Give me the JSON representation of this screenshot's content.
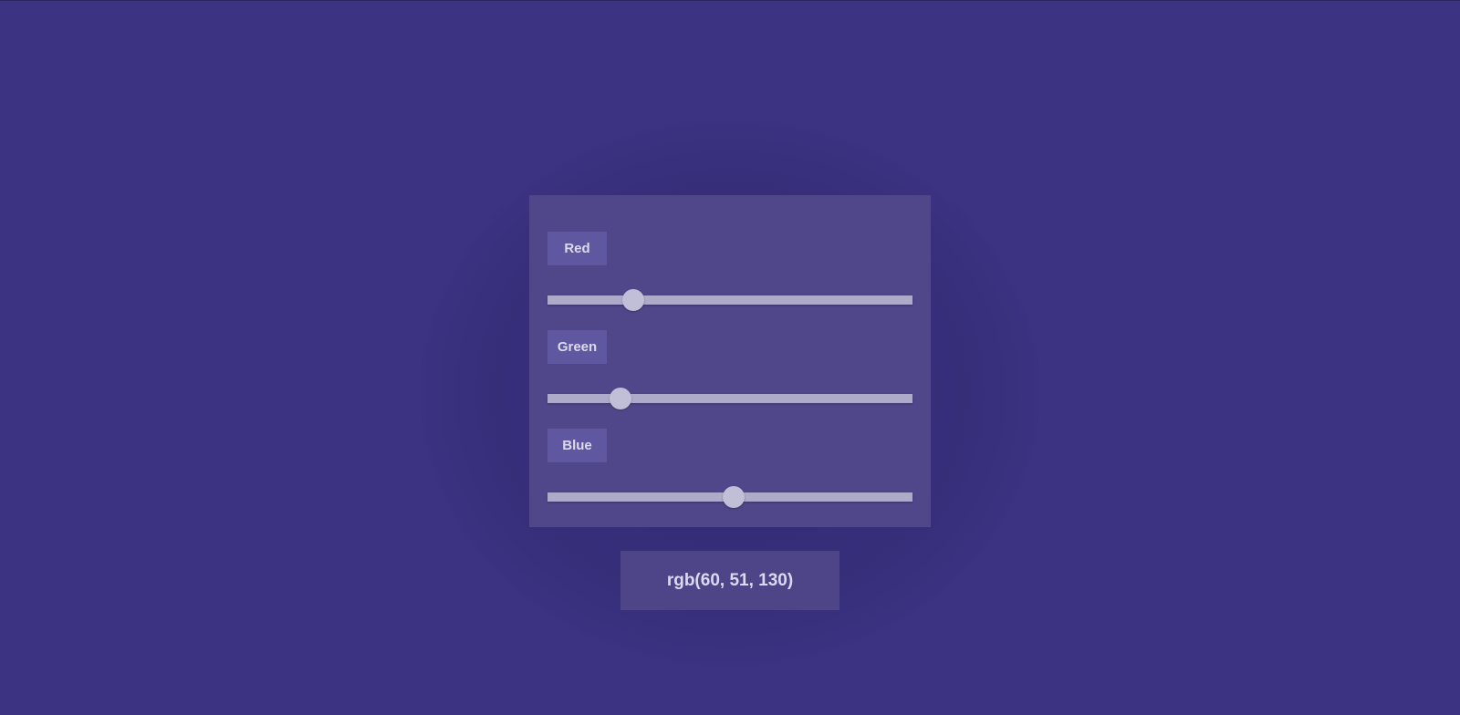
{
  "sliders": [
    {
      "label": "Red",
      "value": 60,
      "max": 255
    },
    {
      "label": "Green",
      "value": 51,
      "max": 255
    },
    {
      "label": "Blue",
      "value": 130,
      "max": 255
    }
  ],
  "result": {
    "text": "rgb(60, 51, 130)"
  },
  "colors": {
    "background": "#3c3382",
    "panel": "#4f4789",
    "label_bg": "#5f58a0",
    "track": "#aeaac9",
    "thumb": "#c1bed8",
    "text": "#dcd9ee"
  }
}
